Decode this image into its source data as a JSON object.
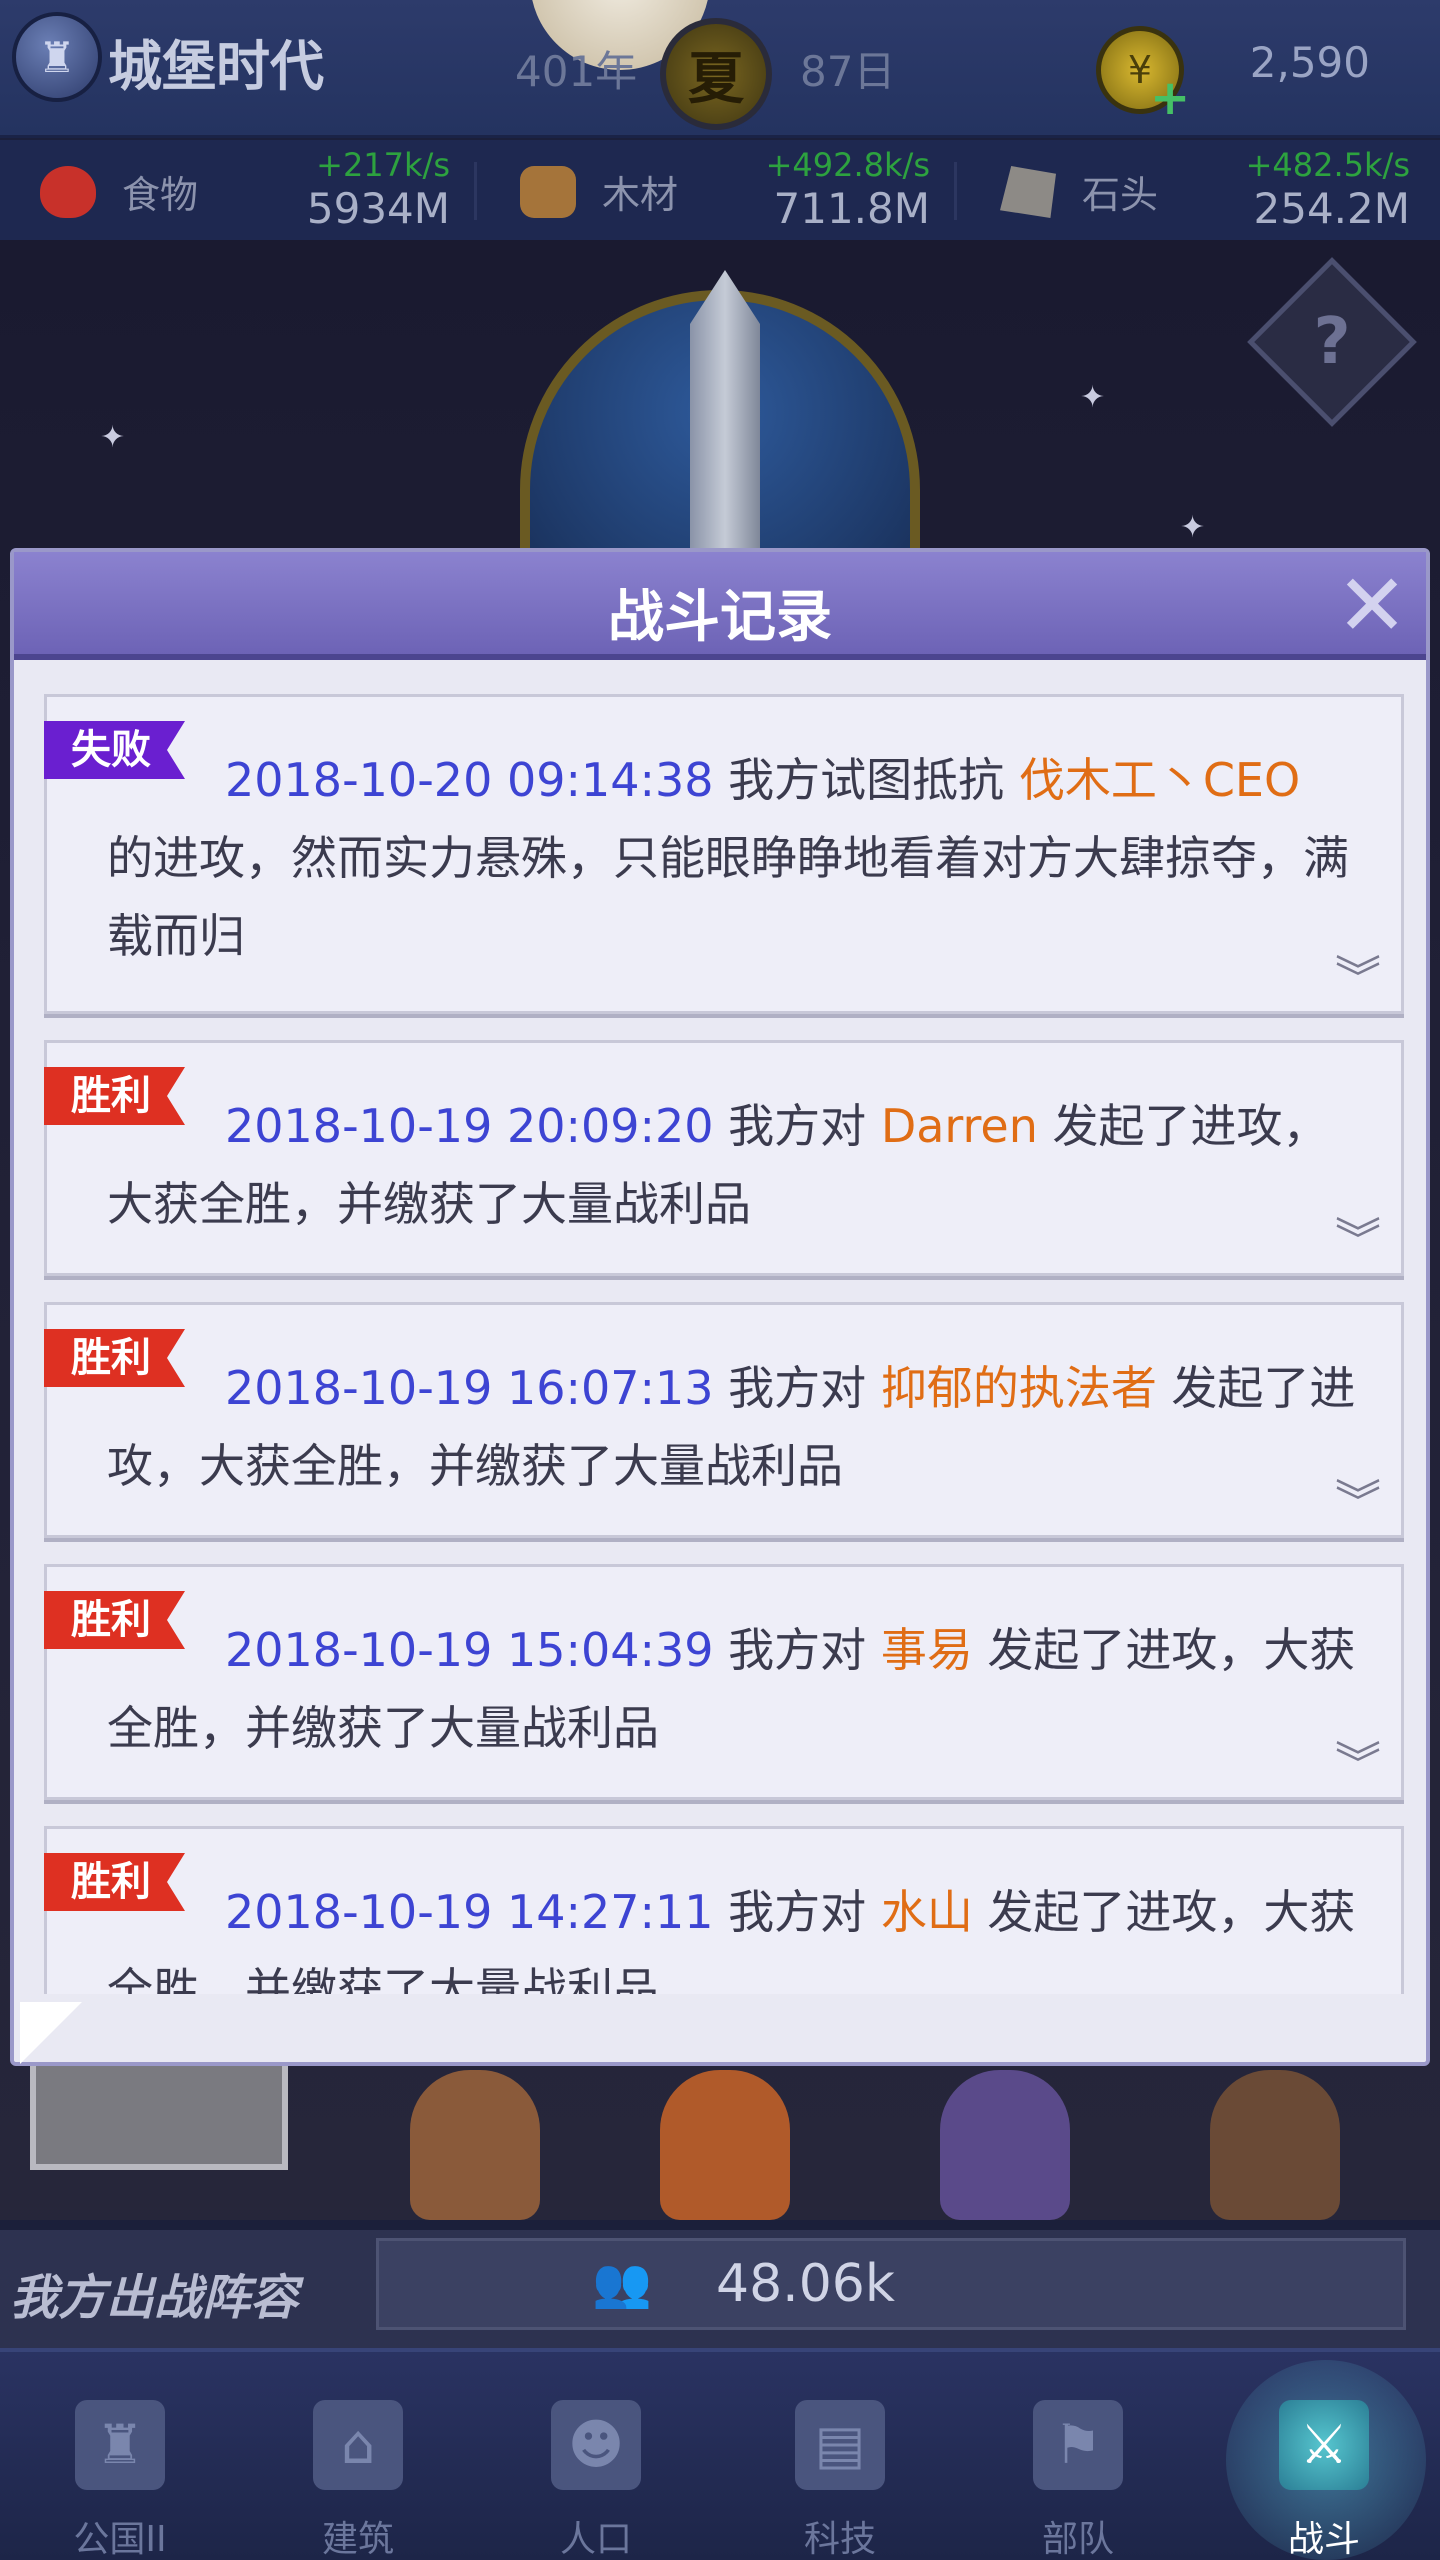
{
  "header": {
    "game_title": "城堡时代",
    "year": "401年",
    "season": "夏",
    "day": "87日",
    "coins": "2,590"
  },
  "resources": [
    {
      "name": "食物",
      "rate": "+217k/s",
      "amount": "5934M",
      "icon": "apple-icon",
      "color": "#c8312a"
    },
    {
      "name": "木材",
      "rate": "+492.8k/s",
      "amount": "711.8M",
      "icon": "wood-logs-icon",
      "color": "#a5743a"
    },
    {
      "name": "石头",
      "rate": "+482.5k/s",
      "amount": "254.2M",
      "icon": "stone-icon",
      "color": "#8d8a86"
    }
  ],
  "modal": {
    "title": "战斗记录",
    "close_glyph": "✕",
    "entries": [
      {
        "result": "失败",
        "result_type": "defeat",
        "timestamp": "2018-10-20 09:14:38",
        "pre": " 我方试图抵抗 ",
        "enemy": "伐木工丶CEO",
        "post": " 的进攻，然而实力悬殊，只能眼睁睁地看着对方大肆掠夺，满载而归"
      },
      {
        "result": "胜利",
        "result_type": "victory",
        "timestamp": "2018-10-19 20:09:20",
        "pre": " 我方对 ",
        "enemy": "Darren",
        "post": " 发起了进攻，大获全胜，并缴获了大量战利品"
      },
      {
        "result": "胜利",
        "result_type": "victory",
        "timestamp": "2018-10-19 16:07:13",
        "pre": " 我方对 ",
        "enemy": "抑郁的执法者",
        "post": " 发起了进攻，大获全胜，并缴获了大量战利品"
      },
      {
        "result": "胜利",
        "result_type": "victory",
        "timestamp": "2018-10-19 15:04:39",
        "pre": " 我方对 ",
        "enemy": "事易",
        "post": " 发起了进攻，大获全胜，并缴获了大量战利品"
      },
      {
        "result": "胜利",
        "result_type": "victory",
        "timestamp": "2018-10-19 14:27:11",
        "pre": " 我方对 ",
        "enemy": "水山",
        "post": " 发起了进攻，大获全胜，并缴获了大量战利品"
      }
    ]
  },
  "lineup": {
    "label": "我方出战阵容",
    "power": "48.06k"
  },
  "nav": [
    {
      "label": "公国II",
      "icon": "castle-icon",
      "glyph": "♜",
      "active": false
    },
    {
      "label": "建筑",
      "icon": "house-icon",
      "glyph": "⌂",
      "active": false
    },
    {
      "label": "人口",
      "icon": "person-icon",
      "glyph": "☻",
      "active": false
    },
    {
      "label": "科技",
      "icon": "book-icon",
      "glyph": "▤",
      "active": false
    },
    {
      "label": "部队",
      "icon": "banner-icon",
      "glyph": "⚑",
      "active": false
    },
    {
      "label": "战斗",
      "icon": "crossed-swords-icon",
      "glyph": "⚔",
      "active": true
    }
  ]
}
